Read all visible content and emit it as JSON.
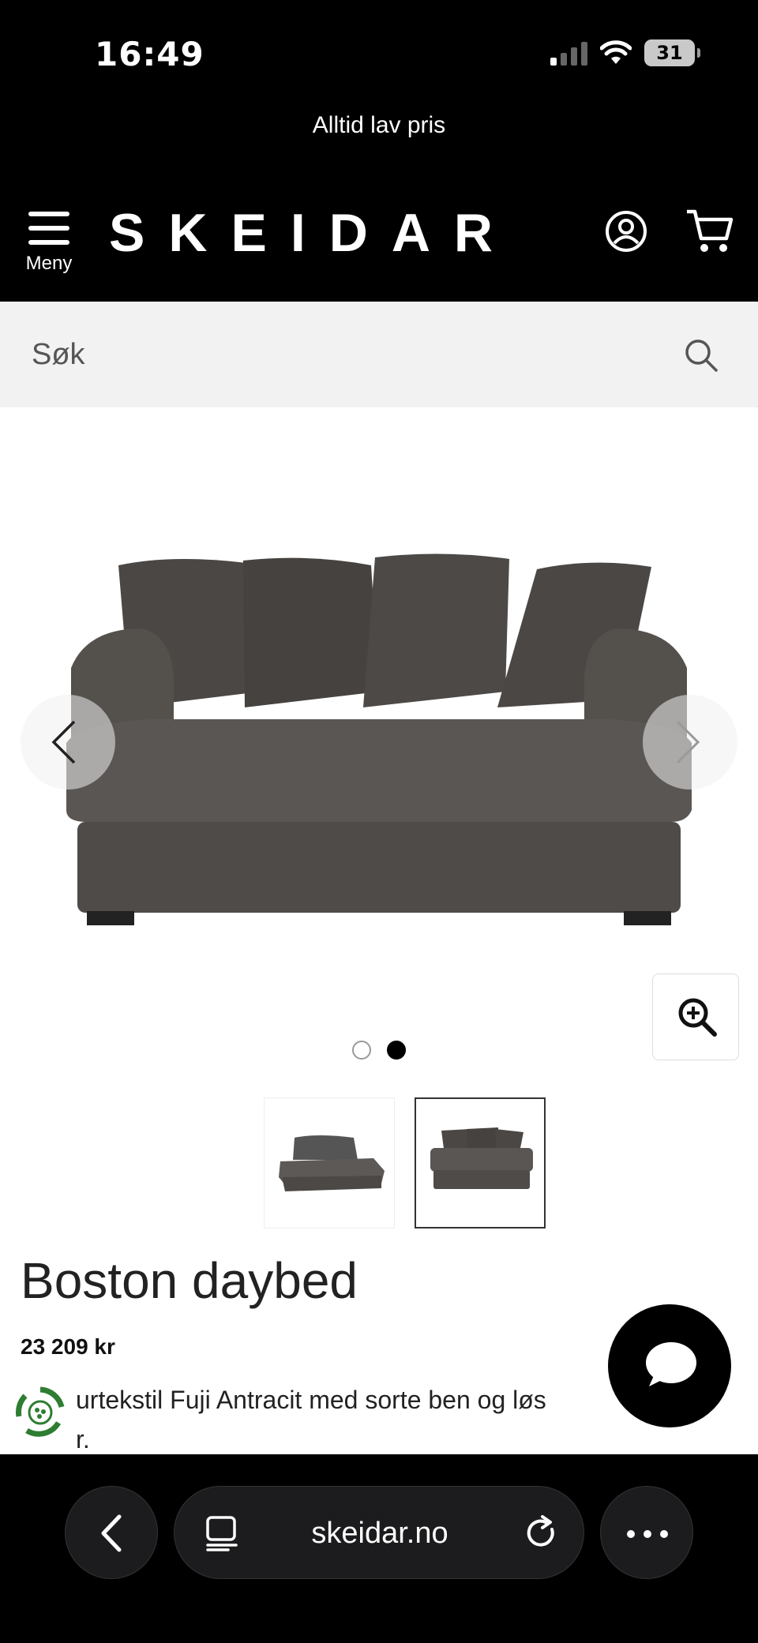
{
  "status_bar": {
    "time": "16:49",
    "battery": "31"
  },
  "header": {
    "promo": "Alltid lav pris",
    "menu_label": "Meny",
    "logo": "SKEIDAR"
  },
  "search": {
    "placeholder": "Søk"
  },
  "gallery": {
    "active_image": 2,
    "image_count": 2
  },
  "product": {
    "title": "Boston daybed",
    "price": "23 209 kr",
    "description_line1": "urtekstil Fuji Antracit med sorte ben og løs",
    "description_line2": "r."
  },
  "browser": {
    "url": "skeidar.no"
  }
}
